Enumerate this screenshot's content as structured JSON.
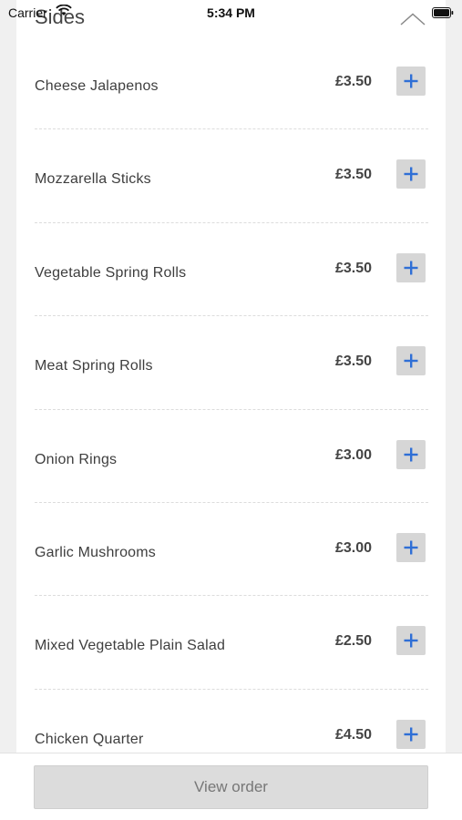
{
  "status_bar": {
    "carrier": "Carrier",
    "time": "5:34 PM"
  },
  "section": {
    "title": "Sides",
    "collapse_icon": "chevron-up-icon"
  },
  "items": [
    {
      "name": "Cheese Jalapenos",
      "price": "£3.50"
    },
    {
      "name": "Mozzarella Sticks",
      "price": "£3.50"
    },
    {
      "name": "Vegetable Spring Rolls",
      "price": "£3.50"
    },
    {
      "name": "Meat Spring Rolls",
      "price": "£3.50"
    },
    {
      "name": "Onion Rings",
      "price": "£3.00"
    },
    {
      "name": "Garlic Mushrooms",
      "price": "£3.00"
    },
    {
      "name": "Mixed Vegetable Plain Salad",
      "price": "£2.50"
    },
    {
      "name": "Chicken Quarter",
      "price": "£4.50"
    }
  ],
  "footer": {
    "view_order_label": "View order"
  },
  "colors": {
    "accent": "#2f6fd6",
    "button_bg": "#d6d6d6"
  }
}
